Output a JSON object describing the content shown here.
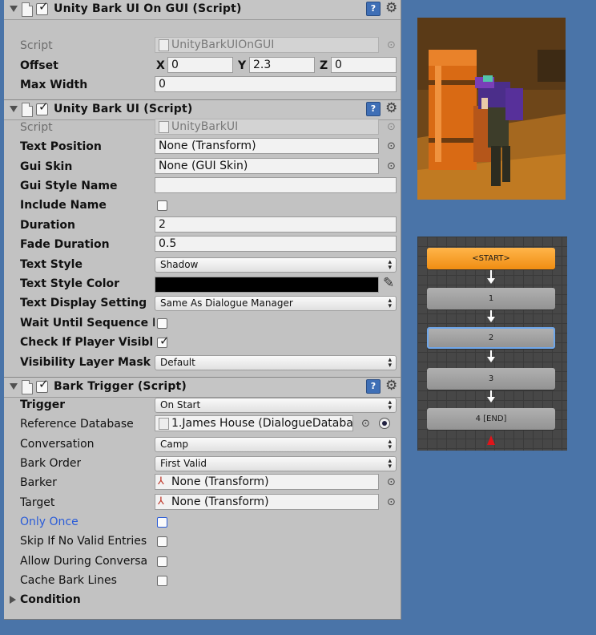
{
  "comp1": {
    "title": "Unity Bark UI On GUI (Script)",
    "script_label": "Script",
    "script_value": "UnityBarkUIOnGUI",
    "offset_label": "Offset",
    "x_label": "X",
    "x_value": "0",
    "y_label": "Y",
    "y_value": "2.3",
    "z_label": "Z",
    "z_value": "0",
    "maxwidth_label": "Max Width",
    "maxwidth_value": "0"
  },
  "comp2": {
    "title": "Unity Bark UI (Script)",
    "script_label": "Script",
    "script_value": "UnityBarkUI",
    "text_position_label": "Text Position",
    "text_position_value": "None (Transform)",
    "gui_skin_label": "Gui Skin",
    "gui_skin_value": "None (GUI Skin)",
    "gui_style_name_label": "Gui Style Name",
    "gui_style_name_value": "",
    "include_name_label": "Include Name",
    "duration_label": "Duration",
    "duration_value": "2",
    "fade_duration_label": "Fade Duration",
    "fade_duration_value": "0.5",
    "text_style_label": "Text Style",
    "text_style_value": "Shadow",
    "text_style_color_label": "Text Style Color",
    "text_style_color": "#000000",
    "text_display_setting_label": "Text Display Setting",
    "text_display_setting_value": "Same As Dialogue Manager",
    "wait_label": "Wait Until Sequence Er",
    "check_visible_label": "Check If Player Visibl",
    "visibility_mask_label": "Visibility Layer Mask",
    "visibility_mask_value": "Default"
  },
  "comp3": {
    "title": "Bark Trigger (Script)",
    "trigger_label": "Trigger",
    "trigger_value": "On Start",
    "refdb_label": "Reference Database",
    "refdb_value": "1.James House (DialogueDataba",
    "conversation_label": "Conversation",
    "conversation_value": "Camp",
    "bark_order_label": "Bark Order",
    "bark_order_value": "First Valid",
    "barker_label": "Barker",
    "barker_value": "None (Transform)",
    "target_label": "Target",
    "target_value": "None (Transform)",
    "only_once_label": "Only Once",
    "skip_label": "Skip If No Valid Entries",
    "allow_label": "Allow During Conversa",
    "cache_label": "Cache Bark Lines",
    "condition_label": "Condition"
  },
  "graph": {
    "nodes": [
      "<START>",
      "1",
      "2",
      "3",
      "4 [END]"
    ]
  },
  "colors": {
    "background": "#4a74a8",
    "inspector": "#c2c2c2",
    "start_node": "#f0911a",
    "link_blue": "#2a5cd8"
  },
  "icons": {
    "help": "?",
    "gear": "⚙"
  }
}
